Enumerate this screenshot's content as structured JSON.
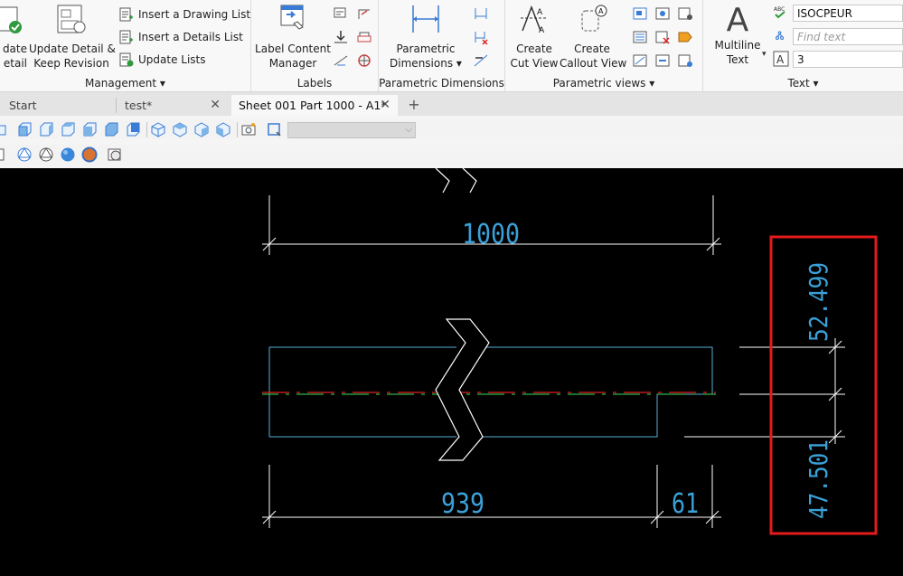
{
  "ribbon": {
    "management": {
      "title": "Management",
      "update_detail_partial": "date\netail",
      "update_keep_line1": "Update Detail &",
      "update_keep_line2": "Keep Revision",
      "insert_drawing_list": "Insert a Drawing List",
      "insert_details_list": "Insert a Details List",
      "update_lists": "Update Lists"
    },
    "labels": {
      "title": "Labels",
      "label_content_line1": "Label Content",
      "label_content_line2": "Manager"
    },
    "parametric_dimensions": {
      "title": "Parametric Dimensions",
      "button_line1": "Parametric",
      "button_line2": "Dimensions"
    },
    "parametric_views": {
      "title": "Parametric views",
      "create_cut_line1": "Create",
      "create_cut_line2": "Cut View",
      "create_callout_line1": "Create",
      "create_callout_line2": "Callout View"
    },
    "text": {
      "title": "Text",
      "multiline_line1": "Multiline",
      "multiline_line2": "Text",
      "font_value": "ISOCPEUR",
      "find_placeholder": "Find text",
      "height_value": "3"
    }
  },
  "tabs": [
    {
      "label": "Start"
    },
    {
      "label": "test*"
    },
    {
      "label": "Sheet 001 Part 1000 - A1*"
    }
  ],
  "drawing": {
    "dim_top": "1000",
    "dim_right_upper": "52.499",
    "dim_right_lower": "47.501",
    "dim_bottom_left": "939",
    "dim_bottom_right": "61"
  },
  "colors": {
    "dimension": "#3aa0d8",
    "outline": "#5aaed6",
    "highlight": "#e31b1b",
    "centerline_red": "#e02020",
    "centerline_green": "#2fb54a"
  }
}
